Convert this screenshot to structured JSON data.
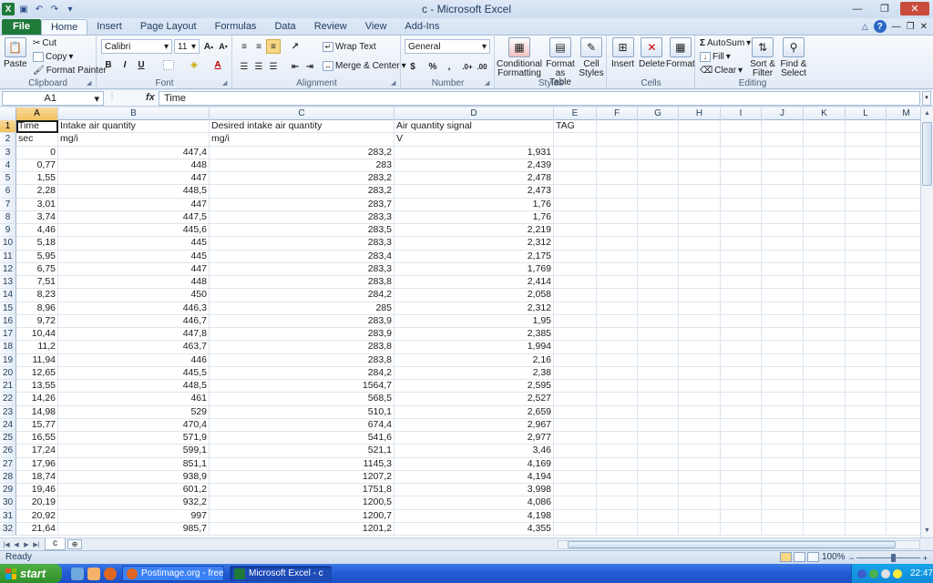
{
  "window": {
    "title": "c  -  Microsoft Excel",
    "qat": [
      "save-icon",
      "undo-icon",
      "redo-icon",
      "customize-icon"
    ]
  },
  "tabs": [
    {
      "label": "File"
    },
    {
      "label": "Home"
    },
    {
      "label": "Insert"
    },
    {
      "label": "Page Layout"
    },
    {
      "label": "Formulas"
    },
    {
      "label": "Data"
    },
    {
      "label": "Review"
    },
    {
      "label": "View"
    },
    {
      "label": "Add-Ins"
    }
  ],
  "ribbon": {
    "clipboard": {
      "label": "Clipboard",
      "paste": "Paste",
      "cut": "Cut",
      "copy": "Copy",
      "format_painter": "Format Painter"
    },
    "font": {
      "label": "Font",
      "name": "Calibri",
      "size": "11",
      "bold": "B",
      "italic": "I",
      "underline": "U"
    },
    "alignment": {
      "label": "Alignment",
      "wrap": "Wrap Text",
      "merge": "Merge & Center"
    },
    "number": {
      "label": "Number",
      "format": "General",
      "percent": "%",
      "comma": ","
    },
    "styles": {
      "label": "Styles",
      "conditional": "Conditional Formatting",
      "format_table": "Format as Table",
      "cell_styles": "Cell Styles"
    },
    "cells": {
      "label": "Cells",
      "insert": "Insert",
      "delete": "Delete",
      "format": "Format"
    },
    "editing": {
      "label": "Editing",
      "autosum": "AutoSum",
      "fill": "Fill",
      "clear": "Clear",
      "sort": "Sort & Filter",
      "find": "Find & Select"
    }
  },
  "formula_bar": {
    "name_box": "A1",
    "fx": "fx",
    "value": "Time"
  },
  "grid": {
    "columns": [
      "A",
      "B",
      "C",
      "D",
      "E",
      "F",
      "G",
      "H",
      "I",
      "J",
      "K",
      "L",
      "M"
    ],
    "row_numbers": [
      "1",
      "2",
      "3",
      "4",
      "5",
      "6",
      "7",
      "8",
      "9",
      "10",
      "11",
      "12",
      "13",
      "14",
      "15",
      "16",
      "17",
      "18",
      "19",
      "20",
      "21",
      "22",
      "23",
      "24",
      "25",
      "26",
      "27",
      "28",
      "29",
      "30",
      "31",
      "32"
    ],
    "headers": [
      "Time",
      "Intake air quantity",
      "Desired intake air quantity",
      "Air quantity signal",
      "TAG"
    ],
    "units": [
      "sec",
      "mg/i",
      "mg/i",
      "V",
      ""
    ],
    "rows": [
      [
        "0",
        "447,4",
        "283,2",
        "1,931"
      ],
      [
        "0,77",
        "448",
        "283",
        "2,439"
      ],
      [
        "1,55",
        "447",
        "283,2",
        "2,478"
      ],
      [
        "2,28",
        "448,5",
        "283,2",
        "2,473"
      ],
      [
        "3,01",
        "447",
        "283,7",
        "1,76"
      ],
      [
        "3,74",
        "447,5",
        "283,3",
        "1,76"
      ],
      [
        "4,46",
        "445,6",
        "283,5",
        "2,219"
      ],
      [
        "5,18",
        "445",
        "283,3",
        "2,312"
      ],
      [
        "5,95",
        "445",
        "283,4",
        "2,175"
      ],
      [
        "6,75",
        "447",
        "283,3",
        "1,769"
      ],
      [
        "7,51",
        "448",
        "283,8",
        "2,414"
      ],
      [
        "8,23",
        "450",
        "284,2",
        "2,058"
      ],
      [
        "8,96",
        "446,3",
        "285",
        "2,312"
      ],
      [
        "9,72",
        "446,7",
        "283,9",
        "1,95"
      ],
      [
        "10,44",
        "447,8",
        "283,9",
        "2,385"
      ],
      [
        "11,2",
        "463,7",
        "283,8",
        "1,994"
      ],
      [
        "11,94",
        "446",
        "283,8",
        "2,16"
      ],
      [
        "12,65",
        "445,5",
        "284,2",
        "2,38"
      ],
      [
        "13,55",
        "448,5",
        "1564,7",
        "2,595"
      ],
      [
        "14,26",
        "461",
        "568,5",
        "2,527"
      ],
      [
        "14,98",
        "529",
        "510,1",
        "2,659"
      ],
      [
        "15,77",
        "470,4",
        "674,4",
        "2,967"
      ],
      [
        "16,55",
        "571,9",
        "541,6",
        "2,977"
      ],
      [
        "17,24",
        "599,1",
        "521,1",
        "3,46"
      ],
      [
        "17,96",
        "851,1",
        "1145,3",
        "4,169"
      ],
      [
        "18,74",
        "938,9",
        "1207,2",
        "4,194"
      ],
      [
        "19,46",
        "601,2",
        "1751,8",
        "3,998"
      ],
      [
        "20,19",
        "932,2",
        "1200,5",
        "4,086"
      ],
      [
        "20,92",
        "997",
        "1200,7",
        "4,198"
      ],
      [
        "21,64",
        "985,7",
        "1201,2",
        "4,355"
      ]
    ]
  },
  "sheets": {
    "active": "c"
  },
  "status": {
    "text": "Ready",
    "zoom": "100%",
    "minus": "−",
    "plus": "+"
  },
  "taskbar": {
    "start": "start",
    "items": [
      {
        "label": "Postimage.org - free i..."
      },
      {
        "label": "Microsoft Excel - c"
      }
    ],
    "clock": "22:47"
  }
}
